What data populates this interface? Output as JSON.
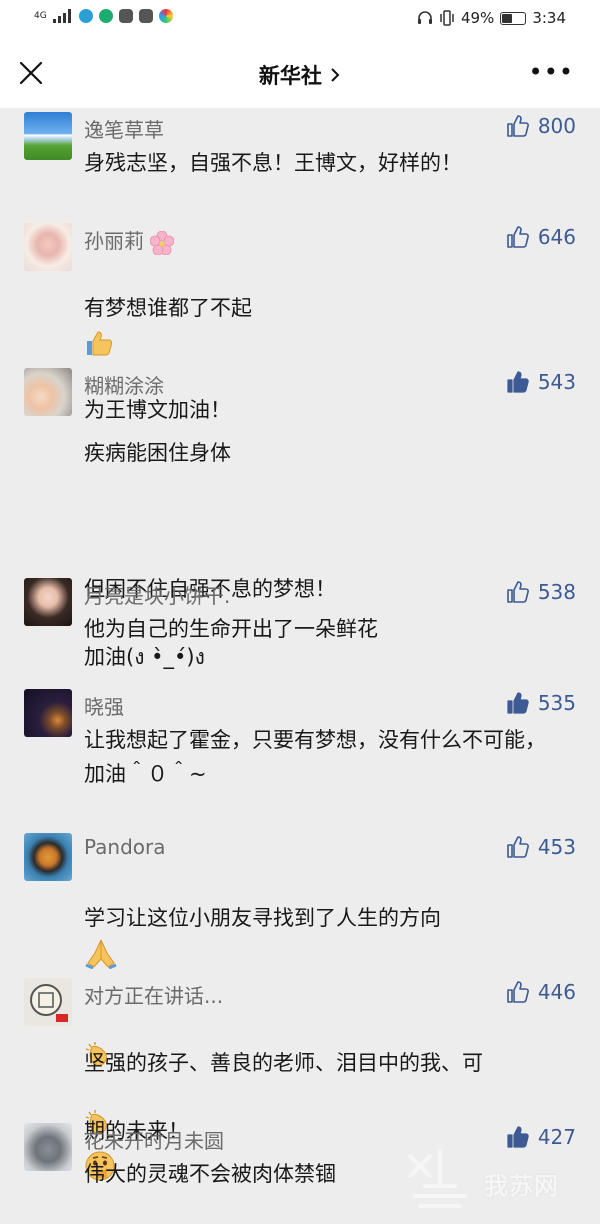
{
  "status_bar": {
    "network": "4G",
    "battery_percent": "49%",
    "battery_level": 0.49,
    "time": "3:34"
  },
  "nav": {
    "title": "新华社",
    "chevron": "chevron-right-icon",
    "more": "•••"
  },
  "comments": [
    {
      "name": "逸笔草草",
      "likes": "800",
      "liked": false,
      "text": "身残志坚，自强不息！王博文，好样的！"
    },
    {
      "name": "孙丽莉",
      "name_emoji": "cherry-blossom",
      "likes": "646",
      "liked": false,
      "text_lines": [
        "有梦想谁都了不起",
        "为王博文加油！"
      ]
    },
    {
      "name": "糊糊涂涂",
      "likes": "543",
      "liked": true,
      "text_lines": [
        "疾病能困住身体",
        "",
        "但困不住自强不息的梦想！",
        "加油(ง •̀_•́)ง"
      ]
    },
    {
      "name": "月亮是块小饼干.",
      "likes": "538",
      "liked": false,
      "text": "他为自己的生命开出了一朵鲜花"
    },
    {
      "name": "晓强",
      "likes": "535",
      "liked": true,
      "text": "让我想起了霍金，只要有梦想，没有什么不可能，加油＾０＾~"
    },
    {
      "name": "Pandora",
      "likes": "453",
      "liked": false,
      "text": "学习让这位小朋友寻找到了人生的方向"
    },
    {
      "name": "对方正在讲话...",
      "likes": "446",
      "liked": false,
      "text_lines": [
        "坚强的孩子、善良的老师、泪目中的我、可",
        "期的未来！"
      ]
    },
    {
      "name": "花未开时月未圆",
      "likes": "427",
      "liked": true,
      "text": "伟大的灵魂不会被肉体禁锢"
    }
  ],
  "watermark": {
    "text": "我苏网"
  },
  "colors": {
    "accent_blue": "#3d5a94",
    "background": "#ededed",
    "name_gray": "#6b6b6b"
  }
}
